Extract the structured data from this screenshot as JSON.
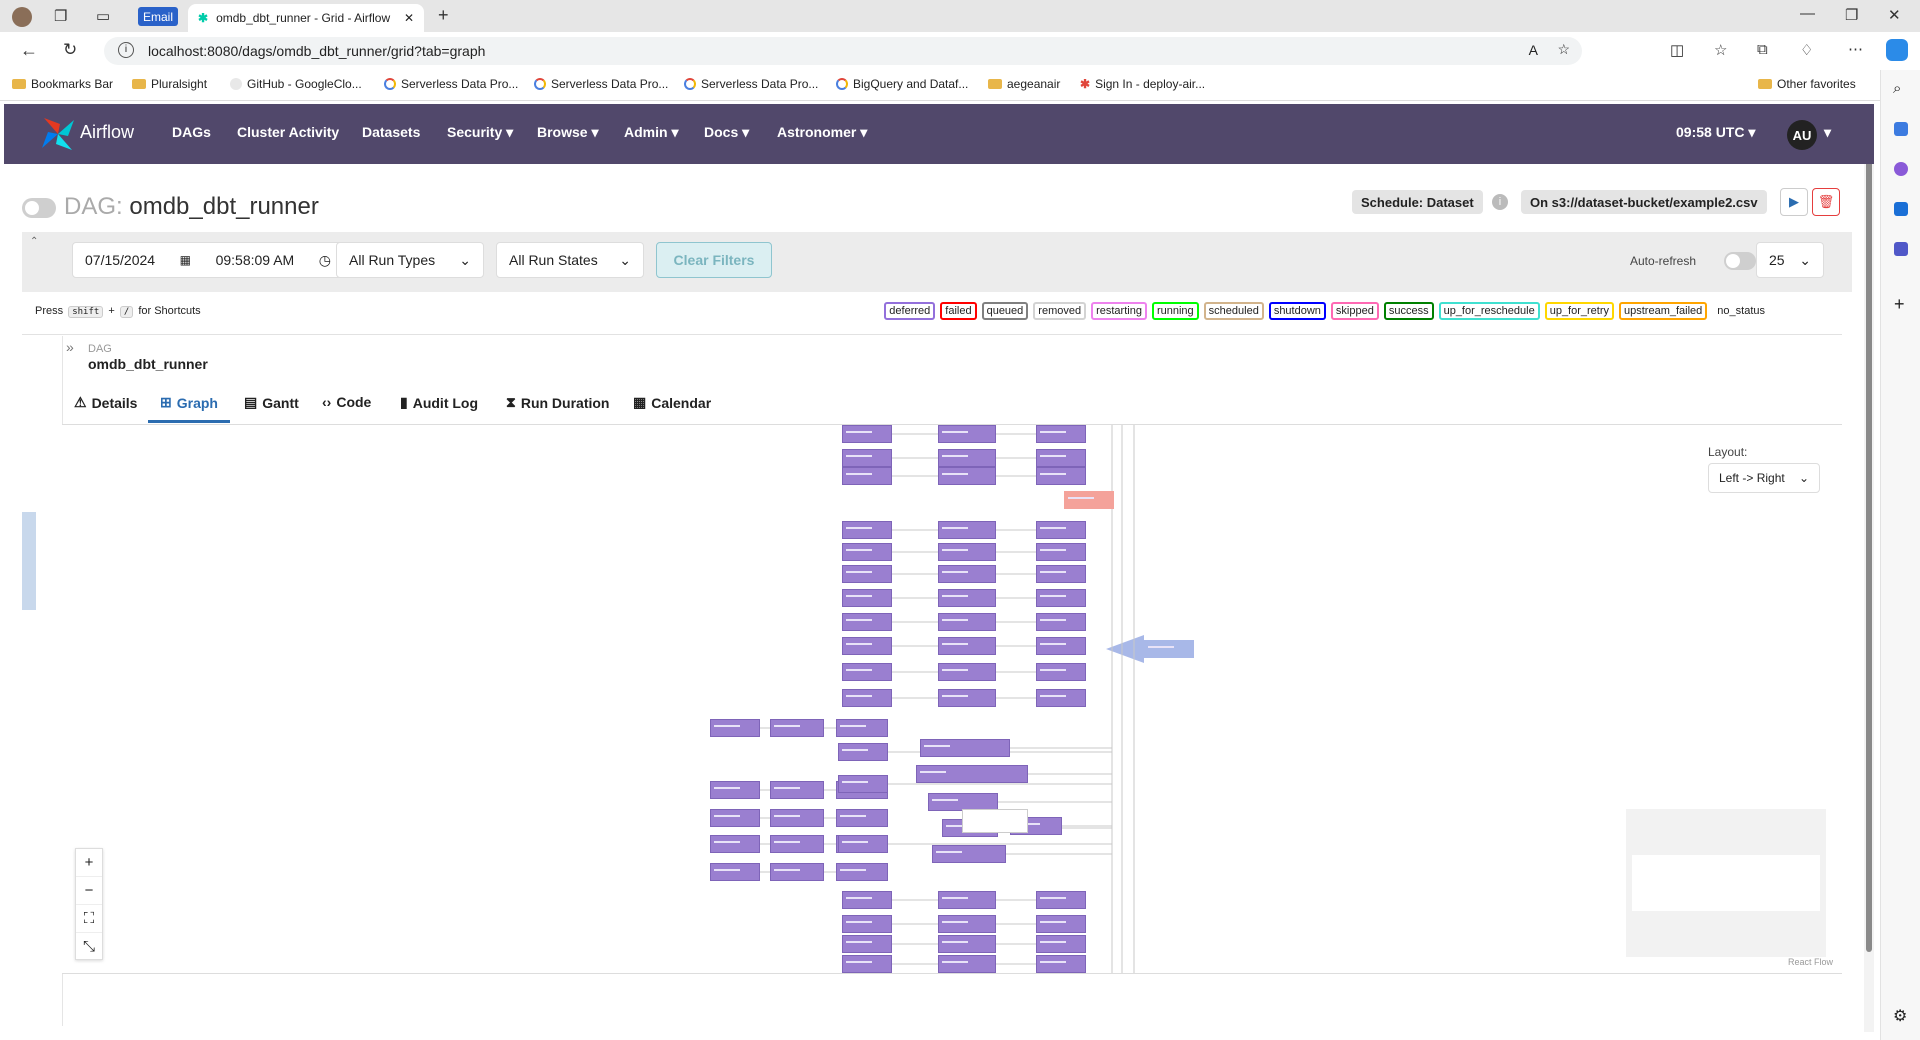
{
  "browser": {
    "email_label": "Email",
    "tab_title": "omdb_dbt_runner - Grid - Airflow",
    "url": "localhost:8080/dags/omdb_dbt_runner/grid?tab=graph",
    "bookmarks": [
      "Bookmarks Bar",
      "Pluralsight",
      "GitHub - GoogleClo...",
      "Serverless Data Pro...",
      "Serverless Data Pro...",
      "Serverless Data Pro...",
      "BigQuery and Dataf...",
      "aegeanair",
      "Sign In - deploy-air..."
    ],
    "other_favorites": "Other favorites"
  },
  "airflow_nav": {
    "brand": "Airflow",
    "items": [
      "DAGs",
      "Cluster Activity",
      "Datasets",
      "Security",
      "Browse",
      "Admin",
      "Docs",
      "Astronomer"
    ],
    "time": "09:58 UTC",
    "user_initials": "AU"
  },
  "dag_header": {
    "prefix": "DAG:",
    "dag_id": "omdb_dbt_runner",
    "schedule": "Schedule: Dataset",
    "trigger_dataset": "On s3://dataset-bucket/example2.csv"
  },
  "filters": {
    "date": "07/15/2024",
    "time": "09:58:09 AM",
    "run_types": "All Run Types",
    "run_states": "All Run States",
    "clear": "Clear Filters",
    "auto_refresh": "Auto-refresh",
    "num_runs": "25"
  },
  "shortcuts": {
    "press": "Press",
    "shift": "shift",
    "plus": "+",
    "slash": "/",
    "for": "for Shortcuts"
  },
  "legend": [
    {
      "label": "deferred",
      "color": "#9370db"
    },
    {
      "label": "failed",
      "color": "#ff0000"
    },
    {
      "label": "queued",
      "color": "#808080"
    },
    {
      "label": "removed",
      "color": "#d3d3d3"
    },
    {
      "label": "restarting",
      "color": "#ee82ee"
    },
    {
      "label": "running",
      "color": "#00ff00"
    },
    {
      "label": "scheduled",
      "color": "#d2b48c"
    },
    {
      "label": "shutdown",
      "color": "#0000ff"
    },
    {
      "label": "skipped",
      "color": "#ff69b4"
    },
    {
      "label": "success",
      "color": "#008000"
    },
    {
      "label": "up_for_reschedule",
      "color": "#40e0d0"
    },
    {
      "label": "up_for_retry",
      "color": "#ffd700"
    },
    {
      "label": "upstream_failed",
      "color": "#ffa500"
    },
    {
      "label": "no_status",
      "color": "#ffffff"
    }
  ],
  "breadcrumb": {
    "level": "DAG",
    "name": "omdb_dbt_runner"
  },
  "tabs": [
    "Details",
    "Graph",
    "Gantt",
    "Code",
    "Audit Log",
    "Run Duration",
    "Calendar"
  ],
  "graph": {
    "layout_label": "Layout:",
    "layout_value": "Left -> Right",
    "attribution": "React Flow",
    "task_color": "#9a7fd0",
    "failed_task_color": "#f4a29a",
    "dataset_color": "#a8b8e8"
  }
}
